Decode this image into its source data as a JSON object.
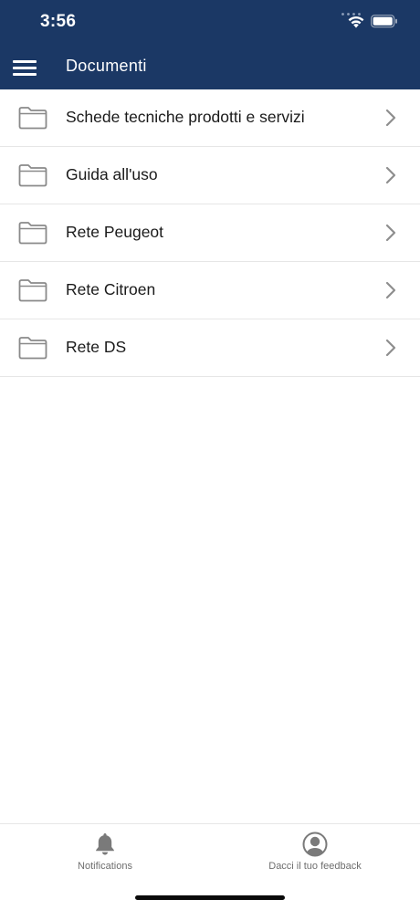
{
  "status_bar": {
    "time": "3:56",
    "icons": [
      "signal-icon",
      "wifi-icon",
      "battery-icon"
    ]
  },
  "header": {
    "title": "Documenti",
    "menu_icon": "hamburger-menu-icon",
    "background": "#1b3865"
  },
  "folders": [
    {
      "label": "Schede tecniche prodotti e servizi",
      "icon": "folder-icon"
    },
    {
      "label": "Guida all'uso",
      "icon": "folder-icon"
    },
    {
      "label": "Rete Peugeot",
      "icon": "folder-icon"
    },
    {
      "label": "Rete Citroen",
      "icon": "folder-icon"
    },
    {
      "label": "Rete DS",
      "icon": "folder-icon"
    }
  ],
  "tabbar": {
    "notifications": {
      "label": "Notifications",
      "icon": "bell-icon"
    },
    "feedback": {
      "label": "Dacci il tuo feedback",
      "icon": "user-avatar-icon"
    }
  }
}
